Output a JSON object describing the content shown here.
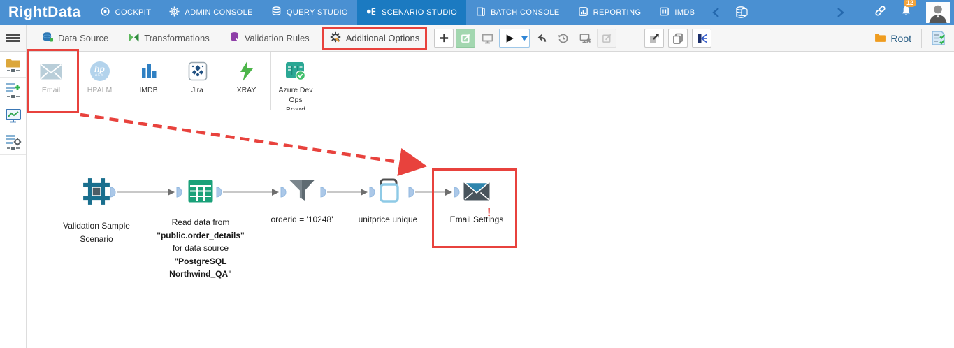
{
  "topbar": {
    "logo": "RightData",
    "nav": [
      {
        "label": "COCKPIT"
      },
      {
        "label": "ADMIN CONSOLE"
      },
      {
        "label": "QUERY STUDIO"
      },
      {
        "label": "SCENARIO STUDIO",
        "active": true
      },
      {
        "label": "BATCH CONSOLE"
      },
      {
        "label": "REPORTING"
      },
      {
        "label": "IMDB"
      }
    ],
    "notification_badge": "12"
  },
  "toolbar": {
    "menu": [
      {
        "label": "Data Source"
      },
      {
        "label": "Transformations"
      },
      {
        "label": "Validation Rules"
      },
      {
        "label": "Additional Options",
        "highlighted": true
      }
    ],
    "root_label": "Root"
  },
  "palette": {
    "items": [
      {
        "label": "Email",
        "disabled": true
      },
      {
        "label": "HPALM",
        "disabled": true,
        "icon_text": "hp",
        "icon_subtext": "ALM"
      },
      {
        "label": "IMDB"
      },
      {
        "label": "Jira"
      },
      {
        "label": "XRAY"
      },
      {
        "label": "Azure Dev Ops Board"
      }
    ]
  },
  "canvas": {
    "node1": {
      "line1": "Validation Sample",
      "line2": "Scenario"
    },
    "node2": {
      "line1": "Read data from",
      "line2": "\"public.order_details\"",
      "line3": "for data source",
      "line4": "\"PostgreSQL",
      "line5": "Northwind_QA\""
    },
    "node3": {
      "label": "orderid = '10248'"
    },
    "node4": {
      "label": "unitprice unique"
    },
    "node5": {
      "label": "Email Settings",
      "alert": "!"
    }
  },
  "colors": {
    "topbar": "#4a90d2",
    "topbar_active": "#1b7ac1",
    "highlight_red": "#e8423d",
    "badge_orange": "#f2a33c"
  }
}
